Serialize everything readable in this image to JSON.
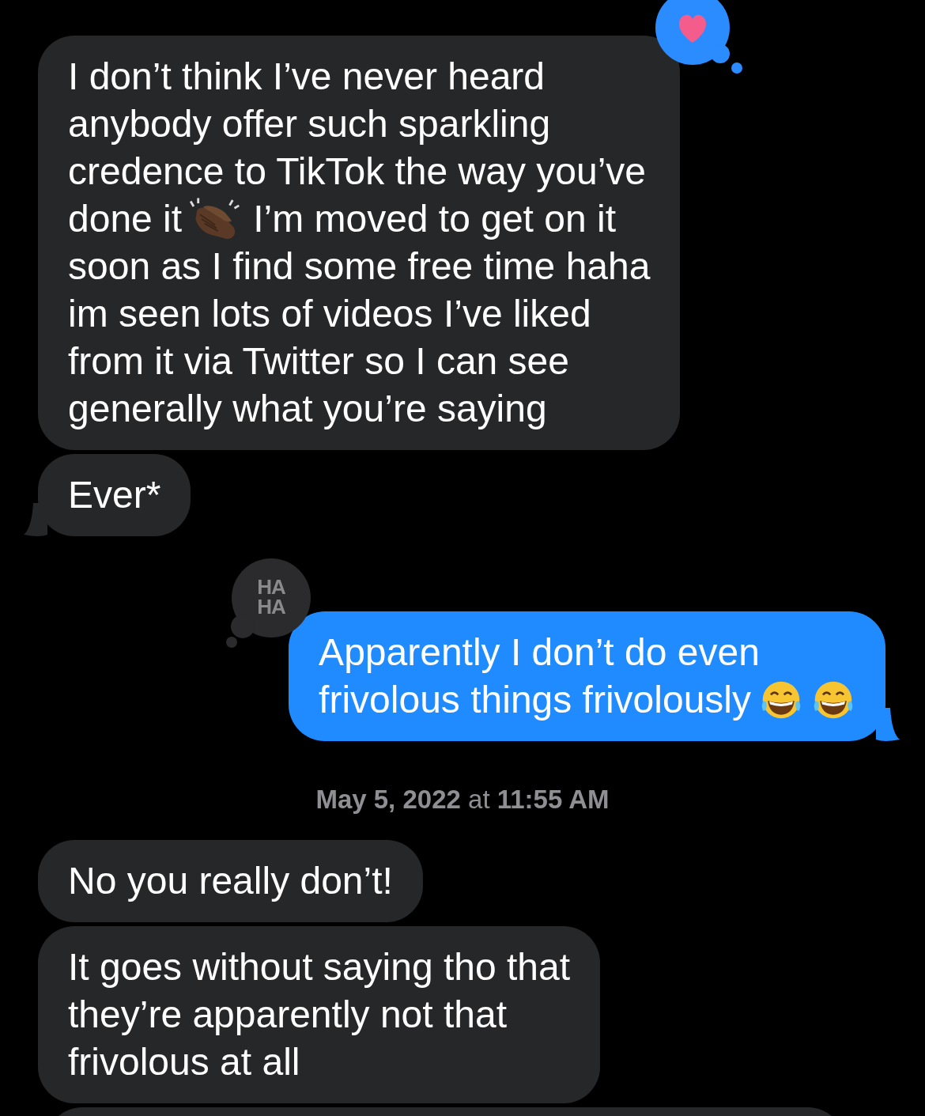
{
  "messages": [
    {
      "kind": "bubble",
      "sent": false,
      "tail": false,
      "reaction": {
        "kind": "heart"
      },
      "lines": [
        [
          {
            "kind": "text",
            "text": "I don’t think I’ve never heard"
          }
        ],
        [
          {
            "kind": "text",
            "text": "anybody offer such sparkling"
          }
        ],
        [
          {
            "kind": "text",
            "text": "credence to TikTok the way you’ve"
          }
        ],
        [
          {
            "kind": "text",
            "text": "done it"
          },
          {
            "kind": "clap"
          },
          {
            "kind": "text",
            "text": "I’m moved to get on it"
          }
        ],
        [
          {
            "kind": "text",
            "text": "soon as I find some free time haha"
          }
        ],
        [
          {
            "kind": "text",
            "text": "im seen lots of videos I’ve liked"
          }
        ],
        [
          {
            "kind": "text",
            "text": "from it via Twitter so I can see"
          }
        ],
        [
          {
            "kind": "text",
            "text": "generally what you’re saying"
          }
        ]
      ]
    },
    {
      "kind": "bubble",
      "sent": false,
      "tail": true,
      "lines": [
        [
          {
            "kind": "text",
            "text": "Ever*"
          }
        ]
      ]
    },
    {
      "kind": "bubble",
      "sent": true,
      "tail": true,
      "reaction": {
        "kind": "haha",
        "label": "HA HA"
      },
      "lines": [
        [
          {
            "kind": "text",
            "text": "Apparently I don’t do even"
          }
        ],
        [
          {
            "kind": "text",
            "text": "frivolous things frivolously"
          },
          {
            "kind": "laugh"
          },
          {
            "kind": "laugh"
          }
        ]
      ]
    },
    {
      "kind": "timestamp",
      "text": "**May 5, 2022** at **11:55 AM**"
    },
    {
      "kind": "bubble",
      "sent": false,
      "tail": false,
      "lines": [
        [
          {
            "kind": "text",
            "text": "No you really don’t!"
          }
        ]
      ]
    },
    {
      "kind": "bubble",
      "sent": false,
      "tail": false,
      "lines": [
        [
          {
            "kind": "text",
            "text": "It goes without saying tho that"
          }
        ],
        [
          {
            "kind": "text",
            "text": "they’re apparently not that"
          }
        ],
        [
          {
            "kind": "text",
            "text": "frivolous at all"
          }
        ]
      ]
    },
    {
      "kind": "stub"
    }
  ]
}
